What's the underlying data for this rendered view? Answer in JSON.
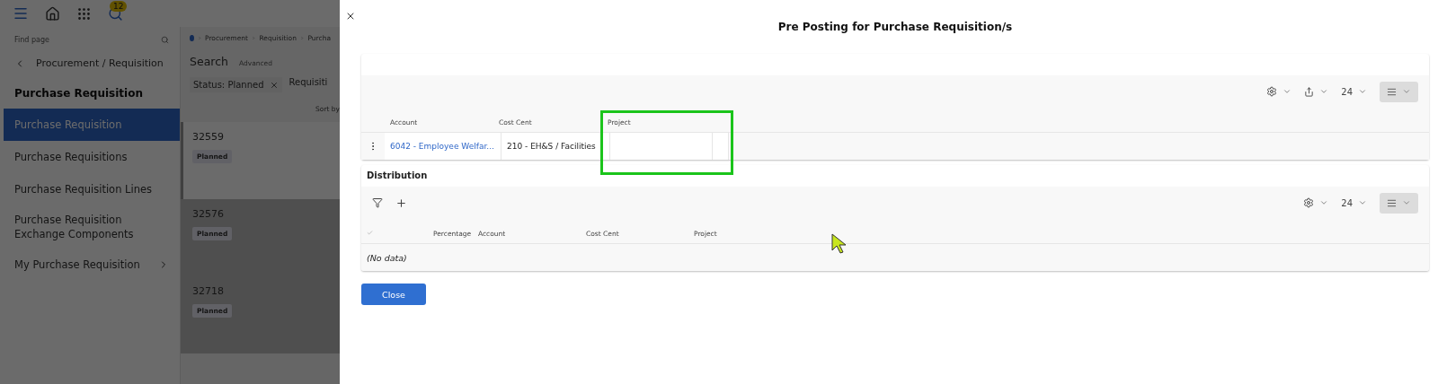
{
  "app": {
    "topbar": {
      "notification_count": "12"
    },
    "sidebar": {
      "search_placeholder": "Find page",
      "back_label": "Procurement / Requisition",
      "heading": "Purchase Requisition",
      "items": [
        {
          "label": "Purchase Requisition",
          "selected": true,
          "has_children": false
        },
        {
          "label": "Purchase Requisitions",
          "selected": false,
          "has_children": false
        },
        {
          "label": "Purchase Requisition Lines",
          "selected": false,
          "has_children": false
        },
        {
          "label": "Purchase Requisition Exchange Components",
          "selected": false,
          "has_children": false
        },
        {
          "label": "My Purchase Requisition",
          "selected": false,
          "has_children": true
        }
      ]
    },
    "main": {
      "breadcrumb": [
        "Procurement",
        "Requisition",
        "Purcha"
      ],
      "search_title": "Search",
      "advanced_link": "Advanced",
      "filter": "Status: Planned",
      "filter_2": "Requisiti",
      "sort_label": "Sort by",
      "cards": [
        {
          "number": "32559",
          "status": "Planned",
          "selected": true
        },
        {
          "number": "32576",
          "status": "Planned",
          "selected": false
        },
        {
          "number": "32718",
          "status": "Planned",
          "selected": false
        }
      ]
    }
  },
  "dialog": {
    "title": "Pre Posting for Purchase Requisition/s",
    "postings": {
      "page_size": "24",
      "columns": [
        "Account",
        "Cost Cent",
        "Project"
      ],
      "rows": [
        {
          "account": "6042 - Employee Welfar...",
          "cost_center": "210 - EH&S / Facilities"
        }
      ]
    },
    "distribution": {
      "title": "Distribution",
      "page_size": "24",
      "columns": [
        "Percentage",
        "Account",
        "Cost Cent",
        "Project"
      ],
      "empty_text": "(No data)"
    },
    "close_button": "Close"
  }
}
